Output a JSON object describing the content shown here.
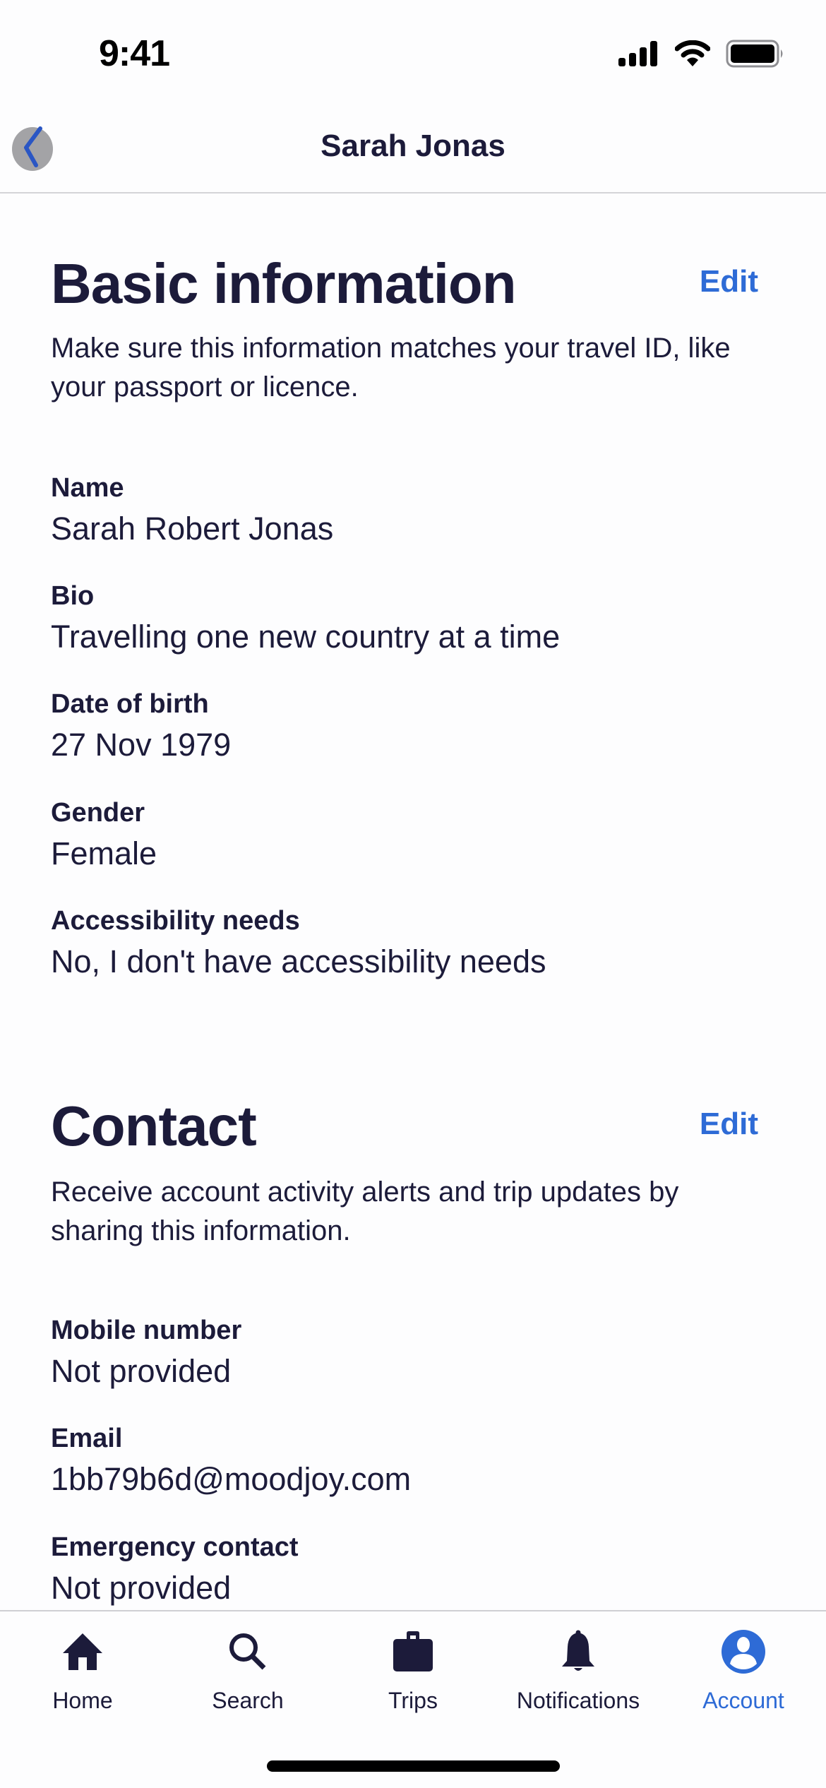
{
  "status_bar": {
    "time": "9:41",
    "icons": [
      "cellular-signal-icon",
      "wifi-icon",
      "battery-icon"
    ]
  },
  "header": {
    "title": "Sarah Jonas",
    "back_icon": "chevron-left-icon"
  },
  "sections": {
    "basic": {
      "title": "Basic information",
      "edit_label": "Edit",
      "description_lines": [
        "Make sure this information matches your travel ID, like",
        "your passport or licence."
      ],
      "fields": [
        {
          "label": "Name",
          "value": "Sarah Robert Jonas"
        },
        {
          "label": "Bio",
          "value": "Travelling one new country at a time"
        },
        {
          "label": "Date of birth",
          "value": "27 Nov 1979"
        },
        {
          "label": "Gender",
          "value": "Female"
        },
        {
          "label": "Accessibility needs",
          "value": "No, I don't have accessibility needs"
        }
      ]
    },
    "contact": {
      "title": "Contact",
      "edit_label": "Edit",
      "description_lines": [
        "Receive account activity alerts and trip updates by",
        "sharing this information."
      ],
      "fields": [
        {
          "label": "Mobile number",
          "value": "Not provided"
        },
        {
          "label": "Email",
          "value": "1bb79b6d@moodjoy.com"
        },
        {
          "label": "Emergency contact",
          "value": "Not provided"
        }
      ]
    }
  },
  "tab_bar": {
    "active": "Account",
    "tabs": [
      {
        "label": "Home",
        "icon": "home-icon"
      },
      {
        "label": "Search",
        "icon": "search-icon"
      },
      {
        "label": "Trips",
        "icon": "briefcase-icon"
      },
      {
        "label": "Notifications",
        "icon": "bell-icon"
      },
      {
        "label": "Account",
        "icon": "account-icon"
      }
    ]
  },
  "colors": {
    "accent": "#2e6bd6",
    "text": "#1c1b3a",
    "background": "#fdfdfe",
    "divider": "#d4d4d8"
  }
}
